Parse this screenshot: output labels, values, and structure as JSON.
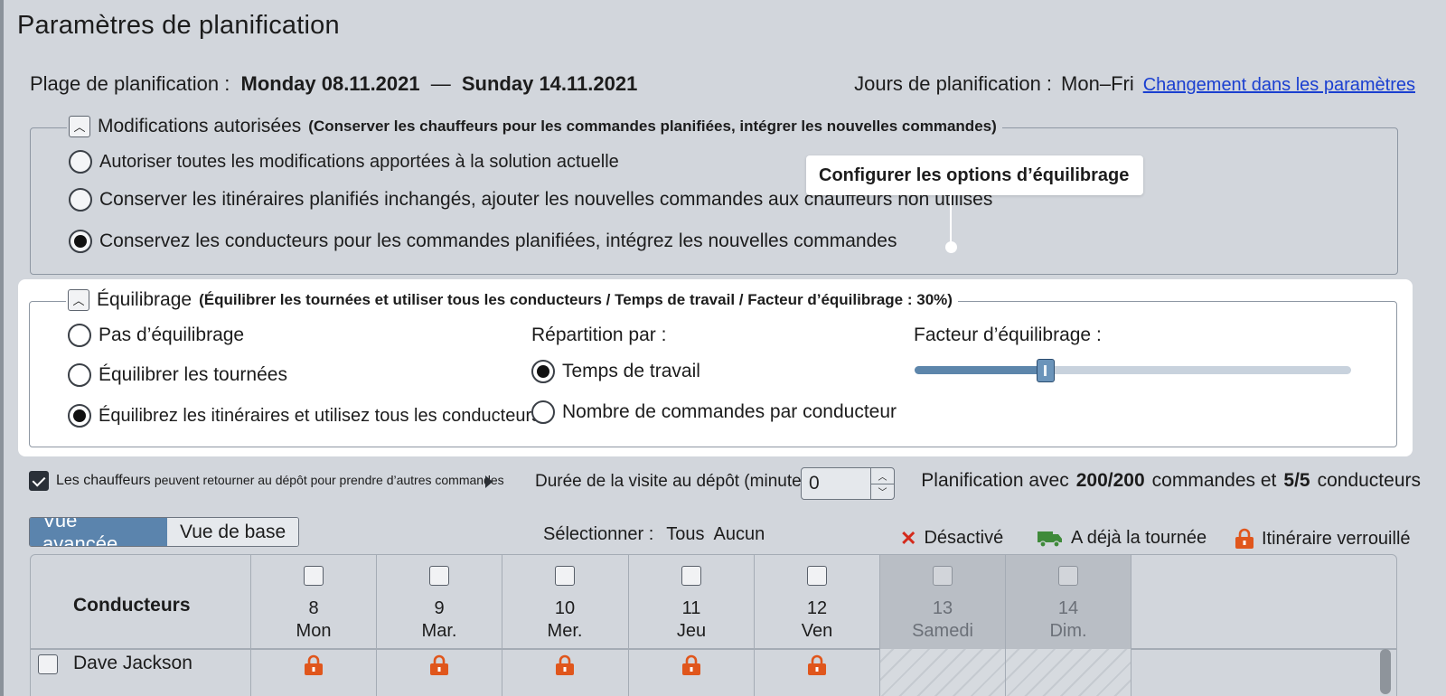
{
  "title": "Paramètres de planification",
  "range": {
    "label": "Plage de planification :",
    "start": "Monday 08.11.2021",
    "separator": "—",
    "end": "Sunday 14.11.2021"
  },
  "planning_days": {
    "label": "Jours de planification :",
    "value": "Mon–Fri",
    "link": "Changement dans les paramètres"
  },
  "modifications": {
    "title": "Modifications autorisées",
    "subtitle": "(Conserver les chauffeurs pour les commandes planifiées, intégrer les nouvelles commandes)",
    "options": [
      {
        "label": "Autoriser toutes les modifications apportées à la solution actuelle",
        "selected": false
      },
      {
        "label": "Conserver les itinéraires planifiés inchangés, ajouter les nouvelles commandes aux chauffeurs non utilisés",
        "selected": false
      },
      {
        "label": "Conservez les conducteurs pour les commandes planifiées, intégrez les nouvelles commandes",
        "selected": true
      }
    ]
  },
  "callout": "Configurer les options d’équilibrage",
  "balancing": {
    "title": "Équilibrage",
    "subtitle": "(Équilibrer les tournées et utiliser tous les conducteurs / Temps de travail / Facteur d’équilibrage : 30%)",
    "options": [
      {
        "label": "Pas d’équilibrage",
        "selected": false
      },
      {
        "label": "Équilibrer les tournées",
        "selected": false
      },
      {
        "label": "Équilibrez les itinéraires et utilisez tous les conducteurs",
        "selected": true
      }
    ],
    "distribution_label": "Répartition par :",
    "distribution_options": [
      {
        "label": "Temps de travail",
        "selected": true
      },
      {
        "label": "Nombre de commandes par conducteur",
        "selected": false
      }
    ],
    "factor_label": "Facteur d’équilibrage :",
    "factor_value": 0.3
  },
  "return_depot": {
    "checked": true,
    "label_bold": "Les chauffeurs",
    "label_rest": "peuvent retourner au dépôt pour prendre d’autres commandes"
  },
  "visit": {
    "label": "Durée de la visite au dépôt (minutes) :",
    "value": "0"
  },
  "summary": {
    "prefix": "Planification avec",
    "orders": "200/200",
    "middle": "commandes et",
    "drivers": "5/5",
    "suffix": "conducteurs"
  },
  "views": {
    "advanced": "Vue avancée",
    "basic": "Vue de base"
  },
  "select": {
    "label": "Sélectionner :",
    "all": "Tous",
    "none": "Aucun"
  },
  "legend": {
    "disabled": "Désactivé",
    "has_tour": "A déjà la tournée",
    "locked": "Itinéraire verrouillé"
  },
  "colors": {
    "accent": "#5b84ad",
    "disabled_red": "#d42a1c",
    "truck_green": "#3f8a3a",
    "lock_orange": "#e0561c"
  },
  "table": {
    "driver_header": "Conducteurs",
    "days": [
      {
        "num": "8",
        "name": "Mon",
        "weekend": false
      },
      {
        "num": "9",
        "name": "Mar.",
        "weekend": false
      },
      {
        "num": "10",
        "name": "Mer.",
        "weekend": false
      },
      {
        "num": "11",
        "name": "Jeu",
        "weekend": false
      },
      {
        "num": "12",
        "name": "Ven",
        "weekend": false
      },
      {
        "num": "13",
        "name": "Samedi",
        "weekend": true
      },
      {
        "num": "14",
        "name": "Dim.",
        "weekend": true
      }
    ],
    "rows": [
      {
        "name": "Dave Jackson",
        "locks": [
          true,
          true,
          true,
          true,
          true,
          false,
          false
        ]
      }
    ]
  }
}
